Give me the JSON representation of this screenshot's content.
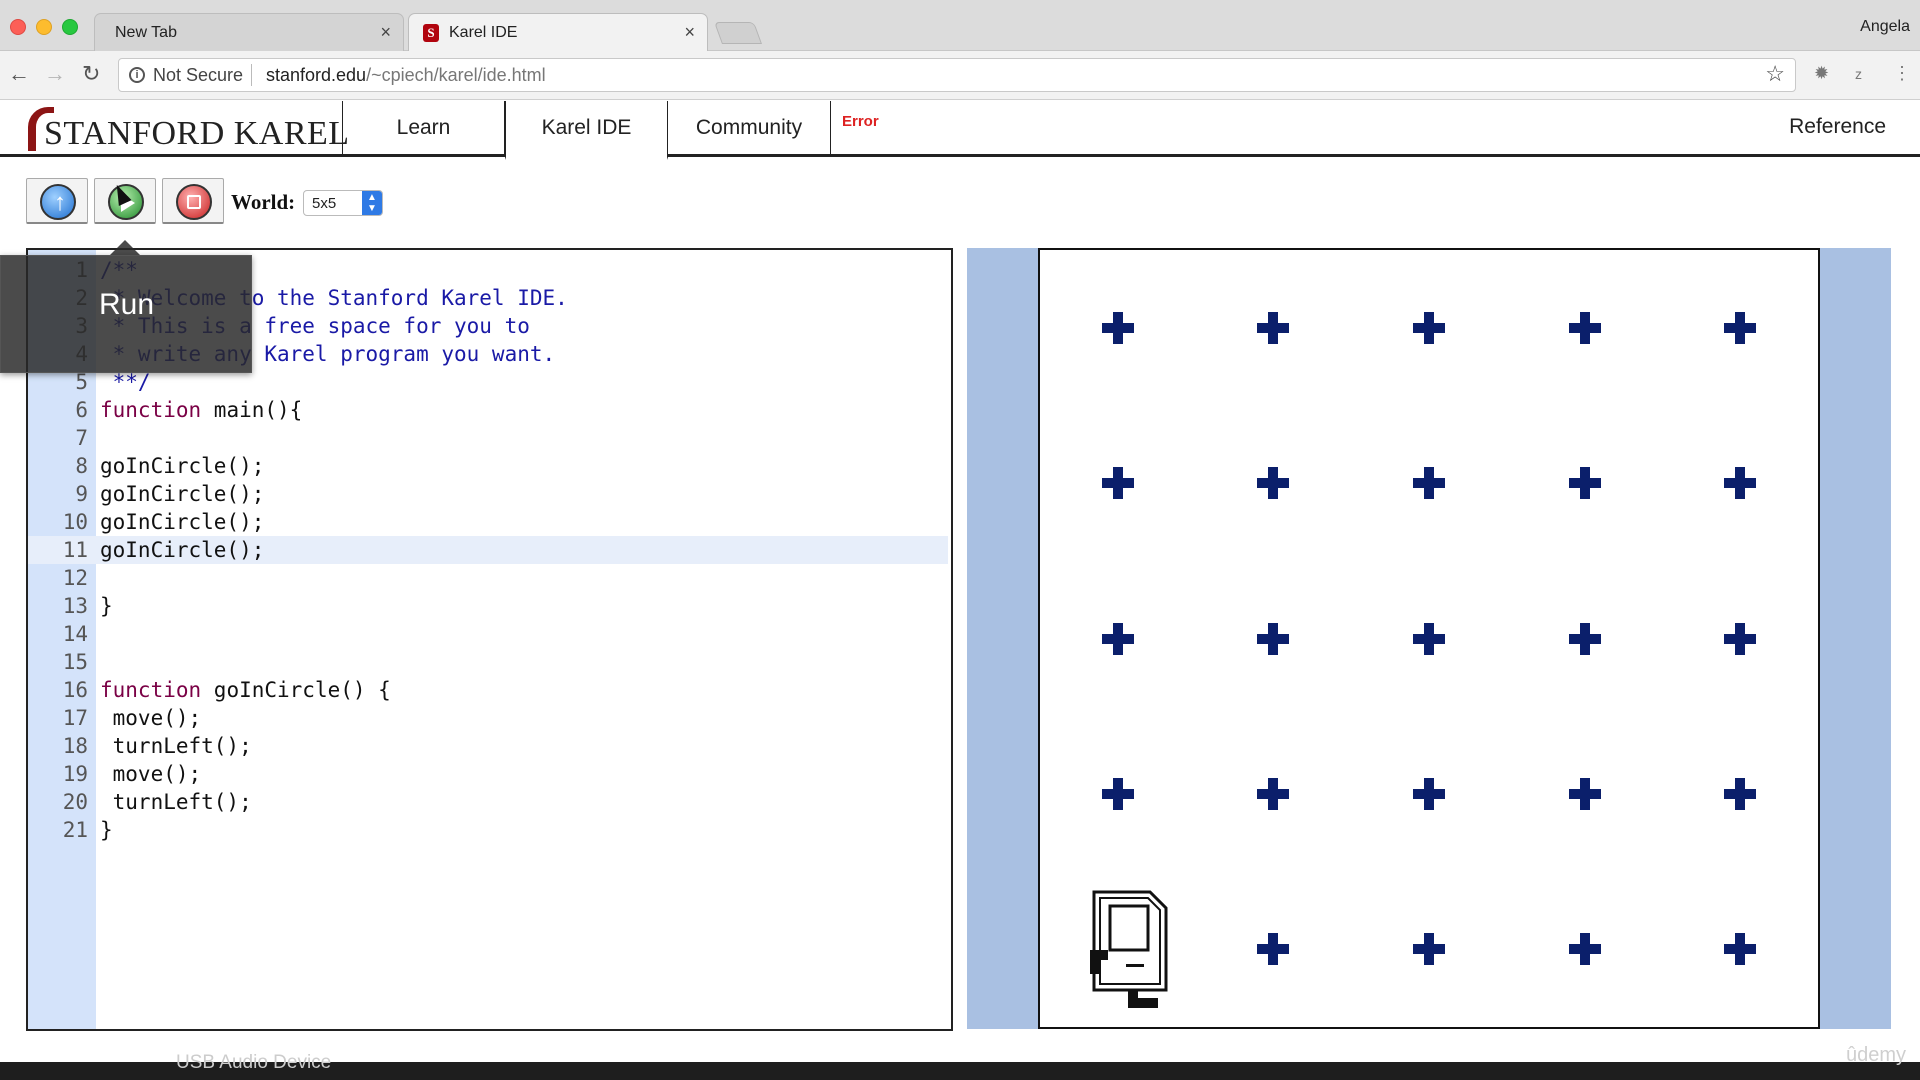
{
  "browser": {
    "tabs": [
      {
        "label": "New Tab",
        "close": "×"
      },
      {
        "label": "Karel IDE",
        "close": "×"
      }
    ],
    "profile": "Angela",
    "security": "Not Secure",
    "url_host": "stanford.edu",
    "url_path": "/~cpiech/karel/ide.html",
    "icons": [
      "back-arrow-icon",
      "forward-arrow-icon",
      "reload-icon",
      "info-icon",
      "star-icon"
    ]
  },
  "site": {
    "logo": "STANFORD KAREL",
    "nav": {
      "learn": "Learn",
      "ide": "Karel IDE",
      "community": "Community",
      "reference": "Reference"
    },
    "error": "Error"
  },
  "controls": {
    "world_label": "World:",
    "world_value": "5x5",
    "tooltip": "Run"
  },
  "editor": {
    "active_line": 11,
    "lines": [
      {
        "n": "1",
        "text": "/**",
        "type": "comment"
      },
      {
        "n": "2",
        "text": " * Welcome to the Stanford Karel IDE.",
        "type": "comment"
      },
      {
        "n": "3",
        "text": " * This is a free space for you to",
        "type": "comment"
      },
      {
        "n": "4",
        "text": " * write any Karel program you want.",
        "type": "comment"
      },
      {
        "n": "5",
        "text": " **/",
        "type": "comment"
      },
      {
        "n": "6",
        "text": "function main(){",
        "type": "code"
      },
      {
        "n": "7",
        "text": "",
        "type": "code"
      },
      {
        "n": "8",
        "text": "goInCircle();",
        "type": "code"
      },
      {
        "n": "9",
        "text": "goInCircle();",
        "type": "code"
      },
      {
        "n": "10",
        "text": "goInCircle();",
        "type": "code"
      },
      {
        "n": "11",
        "text": "goInCircle();",
        "type": "code"
      },
      {
        "n": "12",
        "text": "",
        "type": "code"
      },
      {
        "n": "13",
        "text": "}",
        "type": "code"
      },
      {
        "n": "14",
        "text": "",
        "type": "code"
      },
      {
        "n": "15",
        "text": "",
        "type": "code"
      },
      {
        "n": "16",
        "text": "function goInCircle() {",
        "type": "code"
      },
      {
        "n": "17",
        "text": " move();",
        "type": "code"
      },
      {
        "n": "18",
        "text": " turnLeft();",
        "type": "code"
      },
      {
        "n": "19",
        "text": " move();",
        "type": "code"
      },
      {
        "n": "20",
        "text": " turnLeft();",
        "type": "code"
      },
      {
        "n": "21",
        "text": "}",
        "type": "code"
      }
    ]
  },
  "world": {
    "size": "5x5",
    "karel_position": {
      "column": 1,
      "row": 1
    },
    "beeper_color": "#0b1f6b",
    "background_color": "#a9c0e2"
  },
  "footer": {
    "audio_device": "USB Audio Device",
    "watermark": "ûdemy"
  }
}
